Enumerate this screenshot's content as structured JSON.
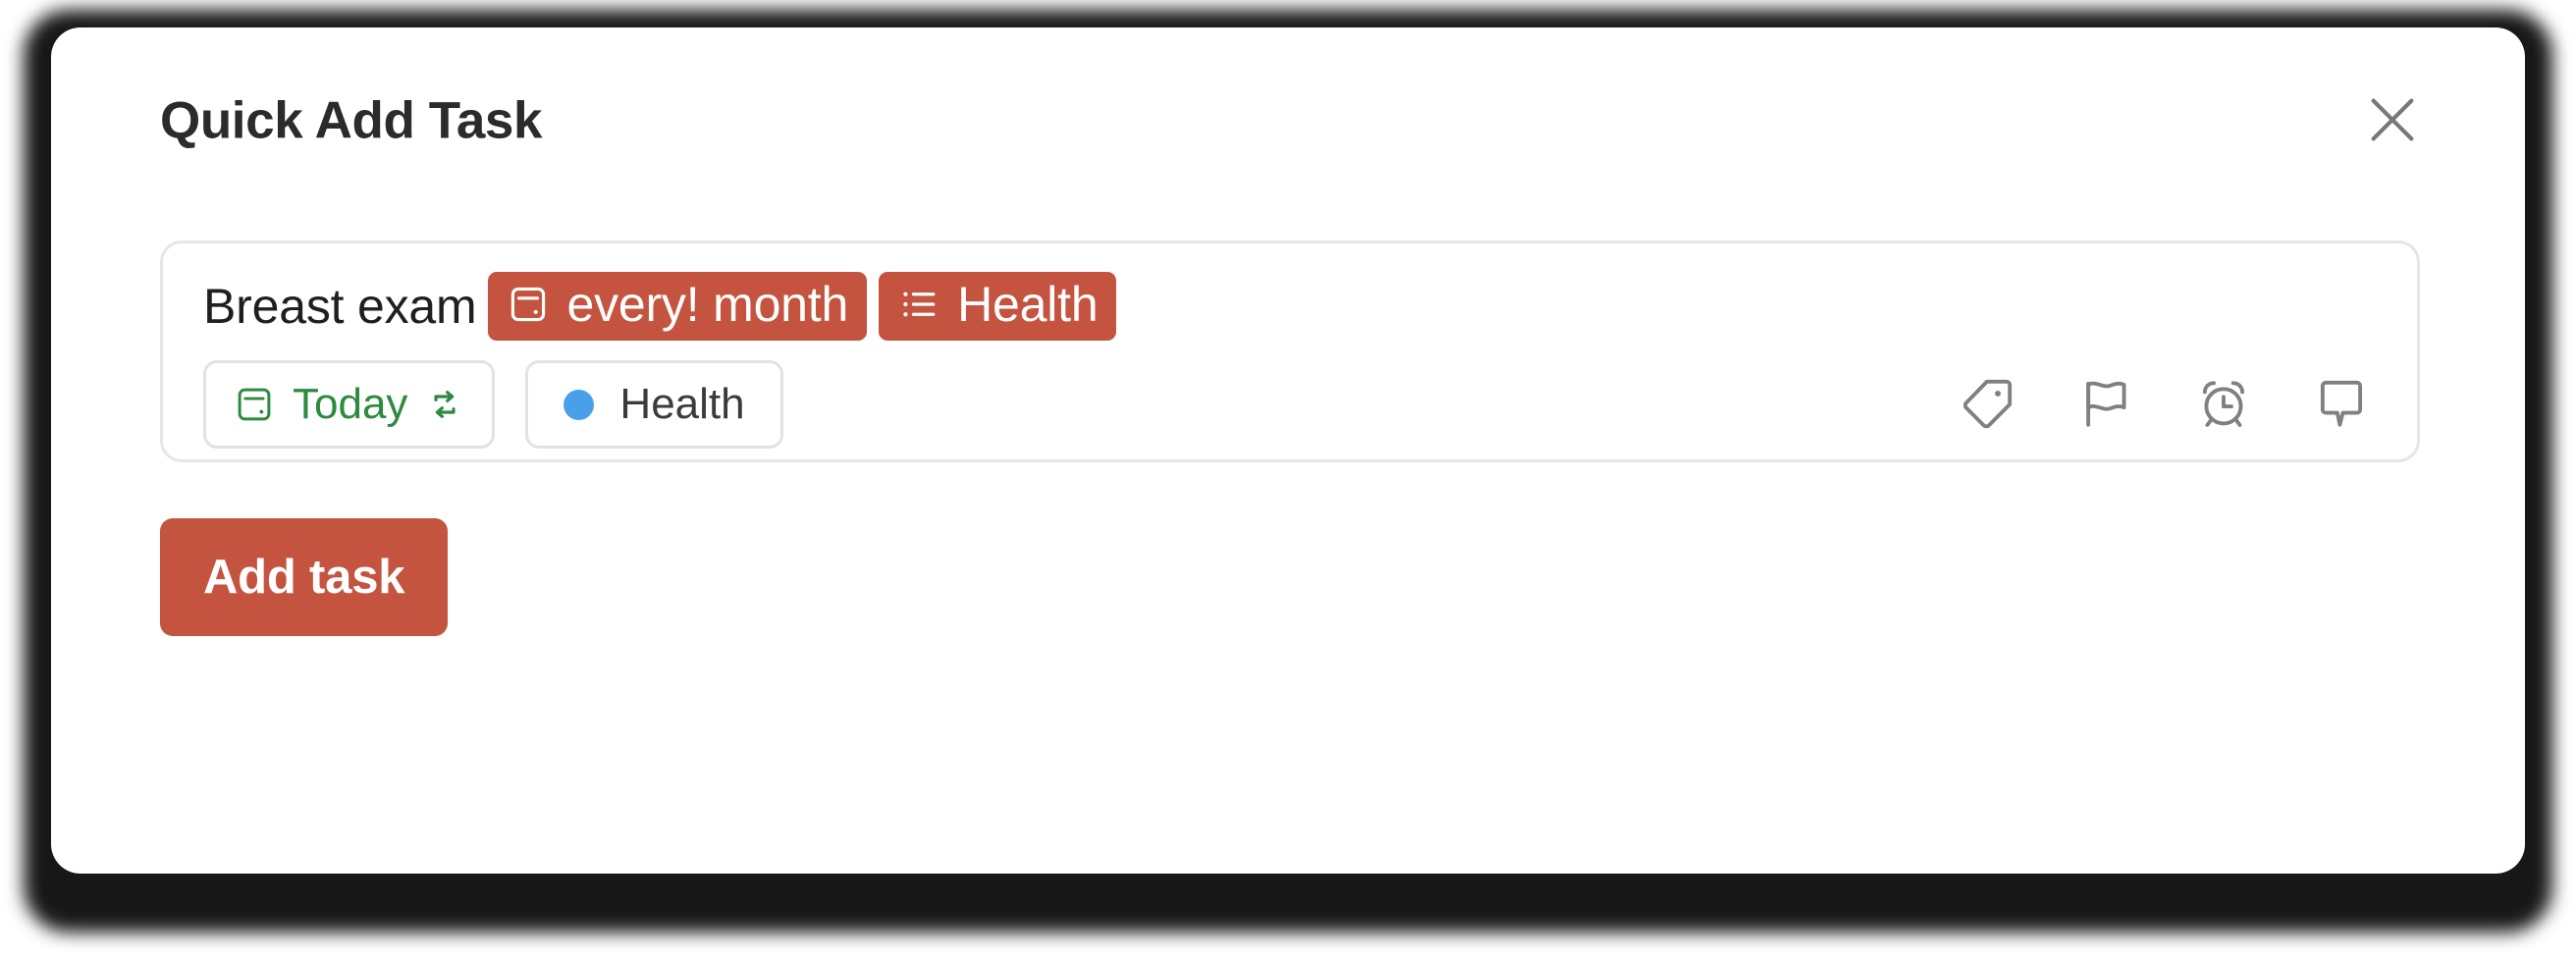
{
  "dialog": {
    "title": "Quick Add Task",
    "close_icon": "close-icon"
  },
  "task_input": {
    "plain_text": "Breast exam",
    "tokens": [
      {
        "icon": "calendar-icon",
        "label": "every! month"
      },
      {
        "icon": "list-icon",
        "label": "Health"
      }
    ],
    "chips": [
      {
        "name": "due-date-chip",
        "icon": "calendar-icon",
        "label": "Today",
        "suffix_icon": "repeat-icon",
        "color": "#2d8a3e"
      },
      {
        "name": "project-chip",
        "icon": "color-dot",
        "label": "Health",
        "dot_color": "#4aa0e8"
      }
    ],
    "actions": [
      {
        "name": "labels-button",
        "icon": "tag-icon"
      },
      {
        "name": "priority-button",
        "icon": "flag-icon"
      },
      {
        "name": "reminders-button",
        "icon": "alarm-clock-icon"
      },
      {
        "name": "comments-button",
        "icon": "comment-icon"
      }
    ]
  },
  "footer": {
    "add_task_label": "Add task"
  },
  "colors": {
    "accent_red": "#c4543f",
    "date_green": "#2d8a3e",
    "project_blue": "#4aa0e8",
    "icon_gray": "#808080",
    "border_gray": "#e2e2e2"
  }
}
